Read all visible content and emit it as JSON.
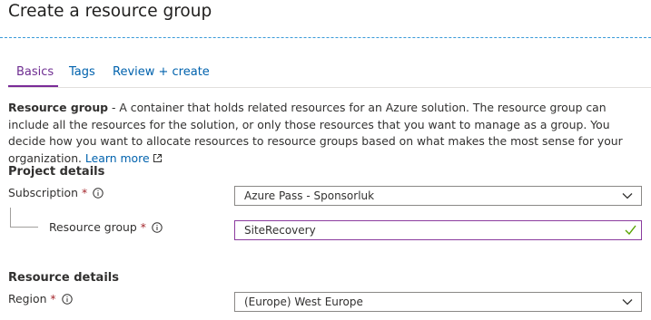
{
  "page": {
    "title": "Create a resource group"
  },
  "tabs": [
    {
      "label": "Basics",
      "active": true
    },
    {
      "label": "Tags",
      "active": false
    },
    {
      "label": "Review + create",
      "active": false
    }
  ],
  "description": {
    "term": "Resource group",
    "text": " - A container that holds related resources for an Azure solution. The resource group can include all the resources for the solution, or only those resources that you want to manage as a group. You decide how you want to allocate resources to resource groups based on what makes the most sense for your organization. ",
    "learn_more": "Learn more",
    "learn_more_icon": "external-link-icon"
  },
  "project_details": {
    "title": "Project details",
    "subscription": {
      "label": "Subscription",
      "required": "*",
      "value": "Azure Pass - Sponsorluk"
    },
    "resource_group": {
      "label": "Resource group",
      "required": "*",
      "value": "SiteRecovery"
    }
  },
  "resource_details": {
    "title": "Resource details",
    "region": {
      "label": "Region",
      "required": "*",
      "value": "(Europe) West Europe"
    }
  },
  "colors": {
    "link": "#0062ad",
    "active_tab": "#6e2d91",
    "required": "#a4262c",
    "valid_check": "#57a300",
    "separator": "#3a9bd9"
  }
}
